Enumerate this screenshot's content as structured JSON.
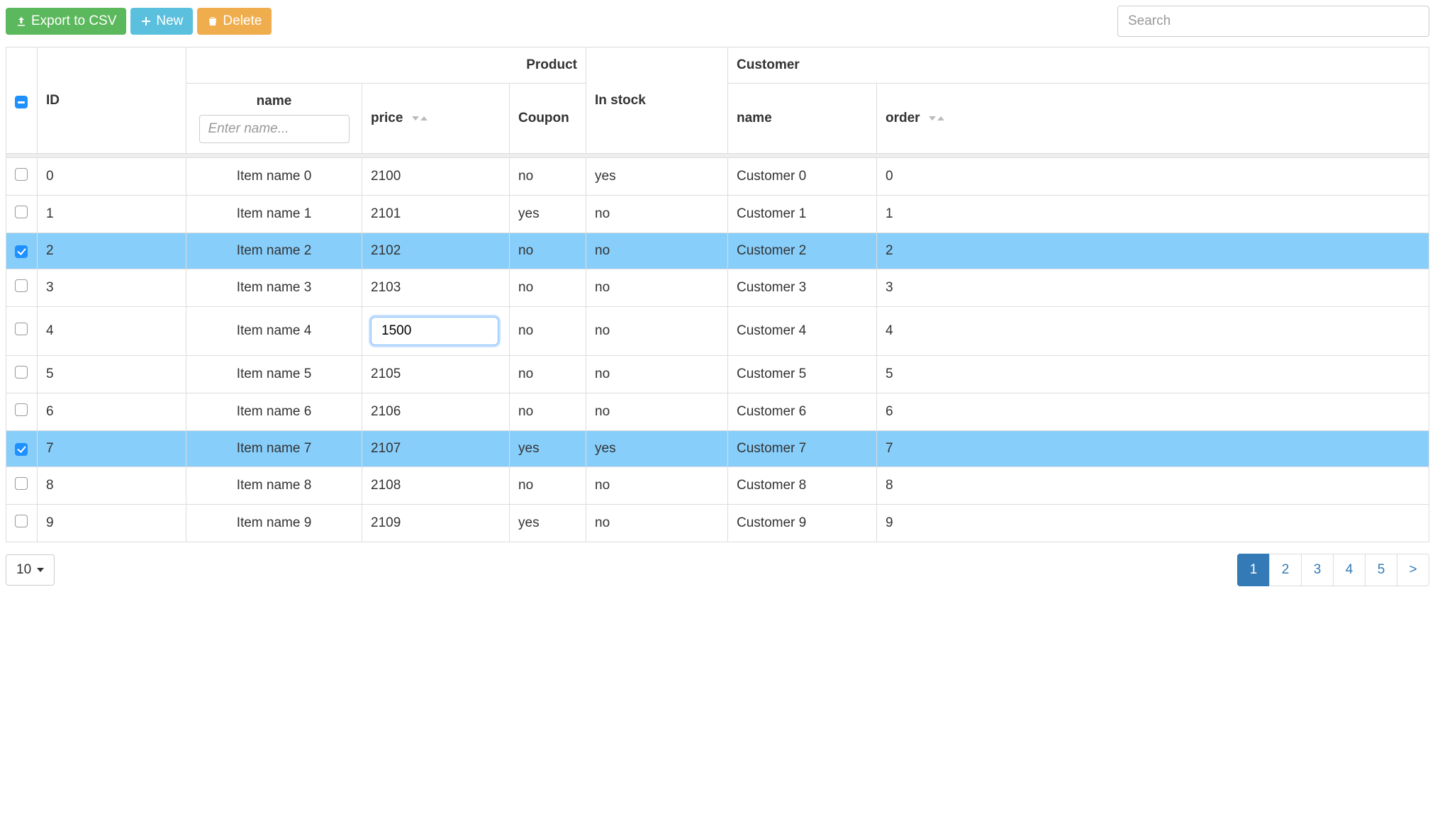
{
  "toolbar": {
    "export_label": "Export to CSV",
    "new_label": "New",
    "delete_label": "Delete",
    "search_placeholder": "Search"
  },
  "headers": {
    "id": "ID",
    "product_group": "Product",
    "name": "name",
    "name_filter_placeholder": "Enter name...",
    "price": "price",
    "coupon": "Coupon",
    "in_stock": "In stock",
    "customer_group": "Customer",
    "customer_name": "name",
    "order": "order"
  },
  "rows": [
    {
      "selected": false,
      "id": "0",
      "name": "Item name 0",
      "price": "2100",
      "editing": false,
      "coupon": "no",
      "stock": "yes",
      "cname": "Customer 0",
      "order": "0"
    },
    {
      "selected": false,
      "id": "1",
      "name": "Item name 1",
      "price": "2101",
      "editing": false,
      "coupon": "yes",
      "stock": "no",
      "cname": "Customer 1",
      "order": "1"
    },
    {
      "selected": true,
      "id": "2",
      "name": "Item name 2",
      "price": "2102",
      "editing": false,
      "coupon": "no",
      "stock": "no",
      "cname": "Customer 2",
      "order": "2"
    },
    {
      "selected": false,
      "id": "3",
      "name": "Item name 3",
      "price": "2103",
      "editing": false,
      "coupon": "no",
      "stock": "no",
      "cname": "Customer 3",
      "order": "3"
    },
    {
      "selected": false,
      "id": "4",
      "name": "Item name 4",
      "price": "1500",
      "editing": true,
      "coupon": "no",
      "stock": "no",
      "cname": "Customer 4",
      "order": "4"
    },
    {
      "selected": false,
      "id": "5",
      "name": "Item name 5",
      "price": "2105",
      "editing": false,
      "coupon": "no",
      "stock": "no",
      "cname": "Customer 5",
      "order": "5"
    },
    {
      "selected": false,
      "id": "6",
      "name": "Item name 6",
      "price": "2106",
      "editing": false,
      "coupon": "no",
      "stock": "no",
      "cname": "Customer 6",
      "order": "6"
    },
    {
      "selected": true,
      "id": "7",
      "name": "Item name 7",
      "price": "2107",
      "editing": false,
      "coupon": "yes",
      "stock": "yes",
      "cname": "Customer 7",
      "order": "7"
    },
    {
      "selected": false,
      "id": "8",
      "name": "Item name 8",
      "price": "2108",
      "editing": false,
      "coupon": "no",
      "stock": "no",
      "cname": "Customer 8",
      "order": "8"
    },
    {
      "selected": false,
      "id": "9",
      "name": "Item name 9",
      "price": "2109",
      "editing": false,
      "coupon": "yes",
      "stock": "no",
      "cname": "Customer 9",
      "order": "9"
    }
  ],
  "footer": {
    "page_size": "10",
    "pages": [
      "1",
      "2",
      "3",
      "4",
      "5"
    ],
    "active_page": "1",
    "next_label": ">"
  }
}
